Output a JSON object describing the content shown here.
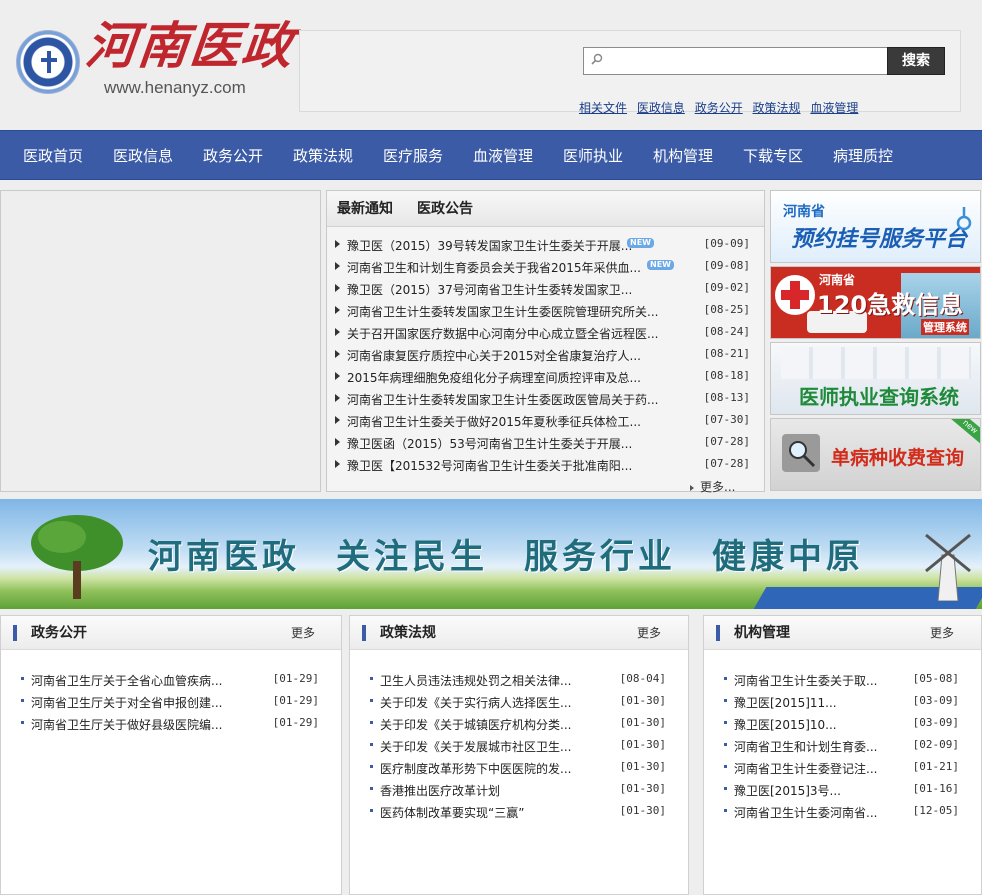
{
  "header": {
    "logo_title": "河南医政",
    "logo_url": "www.henanyz.com"
  },
  "search": {
    "placeholder": "",
    "button_label": "搜索",
    "quick_links": [
      "相关文件",
      "医政信息",
      "政务公开",
      "政策法规",
      "血液管理"
    ]
  },
  "nav": {
    "items": [
      "医政首页",
      "医政信息",
      "政务公开",
      "政策法规",
      "医疗服务",
      "血液管理",
      "医师执业",
      "机构管理",
      "下载专区",
      "病理质控"
    ]
  },
  "notices": {
    "tabs": [
      "最新通知",
      "医政公告"
    ],
    "new_badge": "NEW",
    "items": [
      {
        "title": "豫卫医（2015）39号转发国家卫生计生委关于开展...",
        "date": "[09-09]",
        "new": true
      },
      {
        "title": "河南省卫生和计划生育委员会关于我省2015年采供血...",
        "date": "[09-08]",
        "new": true
      },
      {
        "title": "豫卫医（2015）37号河南省卫生计生委转发国家卫...",
        "date": "[09-02]",
        "new": false
      },
      {
        "title": "河南省卫生计生委转发国家卫生计生委医院管理研究所关...",
        "date": "[08-25]",
        "new": false
      },
      {
        "title": "关于召开国家医疗数据中心河南分中心成立暨全省远程医...",
        "date": "[08-24]",
        "new": false
      },
      {
        "title": "河南省康复医疗质控中心关于2015对全省康复治疗人...",
        "date": "[08-21]",
        "new": false
      },
      {
        "title": "2015年病理细胞免疫组化分子病理室间质控评审及总...",
        "date": "[08-18]",
        "new": false
      },
      {
        "title": "河南省卫生计生委转发国家卫生计生委医政医管局关于药...",
        "date": "[08-13]",
        "new": false
      },
      {
        "title": "河南省卫生计生委关于做好2015年夏秋季征兵体检工...",
        "date": "[07-30]",
        "new": false
      },
      {
        "title": "豫卫医函（2015）53号河南省卫生计生委关于开展...",
        "date": "[07-28]",
        "new": false
      },
      {
        "title": "豫卫医【201532号河南省卫生计生委关于批准南阳...",
        "date": "[07-28]",
        "new": false
      }
    ],
    "more_label": "更多..."
  },
  "side_banners": [
    {
      "region": "河南省",
      "label": "预约挂号服务平台"
    },
    {
      "region": "河南省",
      "label": "120急救信息",
      "sub": "管理系统"
    },
    {
      "label": "医师执业查询系统"
    },
    {
      "label": "单病种收费查询",
      "badge": "new"
    }
  ],
  "slogan": [
    "河南医政",
    "关注民生",
    "服务行业",
    "健康中原"
  ],
  "columns": [
    {
      "title": "政务公开",
      "more_label": "更多",
      "items": [
        {
          "title": "河南省卫生厅关于全省心血管疾病...",
          "date": "[01-29]"
        },
        {
          "title": "河南省卫生厅关于对全省申报创建...",
          "date": "[01-29]"
        },
        {
          "title": "河南省卫生厅关于做好县级医院编...",
          "date": "[01-29]"
        }
      ]
    },
    {
      "title": "政策法规",
      "more_label": "更多",
      "items": [
        {
          "title": "卫生人员违法违规处罚之相关法律...",
          "date": "[08-04]"
        },
        {
          "title": "关于印发《关于实行病人选择医生...",
          "date": "[01-30]"
        },
        {
          "title": "关于印发《关于城镇医疗机构分类...",
          "date": "[01-30]"
        },
        {
          "title": "关于印发《关于发展城市社区卫生...",
          "date": "[01-30]"
        },
        {
          "title": "医疗制度改革形势下中医医院的发...",
          "date": "[01-30]"
        },
        {
          "title": "香港推出医疗改革计划",
          "date": "[01-30]"
        },
        {
          "title": "医药体制改革要实现“三赢”",
          "date": "[01-30]"
        }
      ]
    },
    {
      "title": "机构管理",
      "more_label": "更多",
      "items": [
        {
          "title": "河南省卫生计生委关于取...",
          "date": "[05-08]"
        },
        {
          "title": "豫卫医[2015]11...",
          "date": "[03-09]"
        },
        {
          "title": "豫卫医[2015]10...",
          "date": "[03-09]"
        },
        {
          "title": "河南省卫生和计划生育委...",
          "date": "[02-09]"
        },
        {
          "title": "河南省卫生计生委登记注...",
          "date": "[01-21]"
        },
        {
          "title": "豫卫医[2015]3号...",
          "date": "[01-16]"
        },
        {
          "title": "河南省卫生计生委河南省...",
          "date": "[12-05]"
        }
      ]
    }
  ],
  "colors": {
    "nav_bg": "#3b5ba7",
    "logo_red": "#c0262d",
    "link_blue": "#1a3e8a"
  }
}
